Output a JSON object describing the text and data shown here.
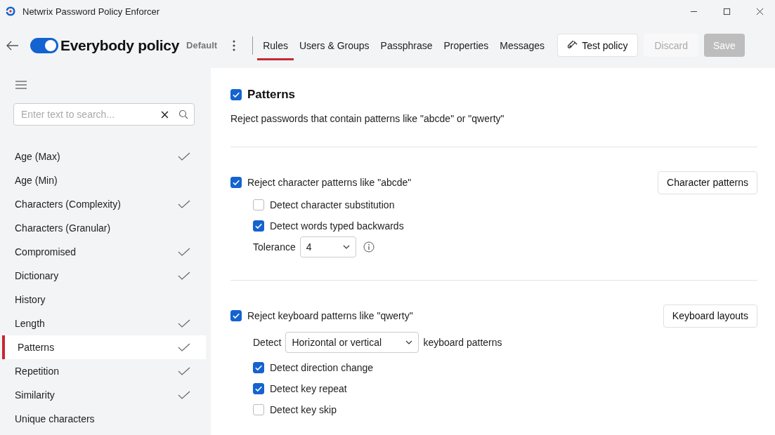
{
  "window": {
    "title": "Netwrix Password Policy Enforcer"
  },
  "header": {
    "enabled": true,
    "policy_name": "Everybody policy",
    "badge": "Default"
  },
  "tabs": [
    {
      "label": "Rules",
      "selected": true
    },
    {
      "label": "Users & Groups",
      "selected": false
    },
    {
      "label": "Passphrase",
      "selected": false
    },
    {
      "label": "Properties",
      "selected": false
    },
    {
      "label": "Messages",
      "selected": false
    }
  ],
  "actions": [
    {
      "label": "Test policy",
      "disabled": false,
      "kind": "test"
    },
    {
      "label": "Discard",
      "disabled": true,
      "kind": "plain"
    },
    {
      "label": "Save",
      "disabled": true,
      "kind": "primary"
    }
  ],
  "sidebar": {
    "search": {
      "placeholder": "Enter text to search..."
    },
    "items": [
      {
        "label": "Age (Max)",
        "checked": true,
        "selected": false
      },
      {
        "label": "Age (Min)",
        "checked": false,
        "selected": false
      },
      {
        "label": "Characters (Complexity)",
        "checked": true,
        "selected": false
      },
      {
        "label": "Characters (Granular)",
        "checked": false,
        "selected": false
      },
      {
        "label": "Compromised",
        "checked": true,
        "selected": false
      },
      {
        "label": "Dictionary",
        "checked": true,
        "selected": false
      },
      {
        "label": "History",
        "checked": false,
        "selected": false
      },
      {
        "label": "Length",
        "checked": true,
        "selected": false
      },
      {
        "label": "Patterns",
        "checked": true,
        "selected": true
      },
      {
        "label": "Repetition",
        "checked": true,
        "selected": false
      },
      {
        "label": "Similarity",
        "checked": true,
        "selected": false
      },
      {
        "label": "Unique characters",
        "checked": false,
        "selected": false
      }
    ]
  },
  "rule": {
    "title": "Patterns",
    "checked": true,
    "description": "Reject passwords that contain patterns like \"abcde\" or \"qwerty\""
  },
  "sections": [
    {
      "label": "Reject character patterns like \"abcde\"",
      "checked": true,
      "button": "Character patterns",
      "items": [
        {
          "kind": "checkbox",
          "label": "Detect character substitution",
          "checked": false
        },
        {
          "kind": "checkbox",
          "label": "Detect words typed backwards",
          "checked": true
        },
        {
          "kind": "select",
          "label": "Tolerance",
          "value": "4"
        }
      ]
    },
    {
      "label": "Reject keyboard patterns like \"qwerty\"",
      "checked": true,
      "button": "Keyboard layouts",
      "items": [
        {
          "kind": "detect",
          "label": "Detect",
          "value": "Horizontal or vertical",
          "suffix": "keyboard patterns"
        },
        {
          "kind": "checkbox",
          "label": "Detect direction change",
          "checked": true
        },
        {
          "kind": "checkbox",
          "label": "Detect key repeat",
          "checked": true
        },
        {
          "kind": "checkbox",
          "label": "Detect key skip",
          "checked": false
        }
      ]
    }
  ]
}
